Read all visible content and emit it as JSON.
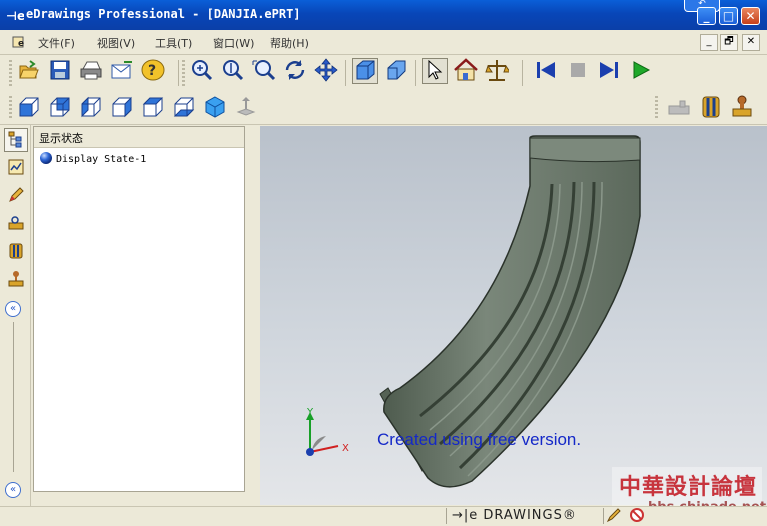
{
  "window": {
    "app_icon": "eDrawings logo",
    "title": "eDrawings Professional - [DANJIA.ePRT]",
    "minimize": "_",
    "maximize": "□",
    "close": "✕",
    "tooltip_tab": "↶"
  },
  "menu": {
    "items": [
      "文件(F)",
      "视图(V)",
      "工具(T)",
      "窗口(W)",
      "帮助(H)"
    ],
    "mdi_minimize": "_",
    "mdi_restore": "🗗",
    "mdi_close": "✕"
  },
  "toolbar1": {
    "icons": [
      "open-icon",
      "save-icon",
      "print-icon",
      "send-mail-icon",
      "help-icon",
      "zoom-to-fit-icon",
      "zoom-in-out-icon",
      "zoom-to-area-icon",
      "rotate-icon",
      "pan-icon",
      "3d-view-icon",
      "shaded-icon",
      "select-icon",
      "home-icon",
      "measure-icon",
      "first-frame-icon",
      "stop-icon",
      "next-frame-icon",
      "play-icon"
    ]
  },
  "toolbar2": {
    "icons": [
      "front-view-icon",
      "back-view-icon",
      "left-view-icon",
      "right-view-icon",
      "top-view-icon",
      "bottom-view-icon",
      "isometric-icon",
      "section-arrow-icon",
      "stamp-disabled-icon",
      "section-view-icon",
      "stamp-icon"
    ]
  },
  "left_strip": {
    "icons": [
      "component-tree-icon",
      "configurations-icon",
      "markup-pen-icon",
      "measure-tool-icon",
      "section-tool-icon",
      "stamp-tool-icon"
    ],
    "collapse_top": "«",
    "collapse_bottom": "«"
  },
  "panel": {
    "title": "显示状态",
    "items": [
      {
        "label": "Display State-1",
        "icon": "blue-sphere-icon"
      }
    ]
  },
  "viewport": {
    "watermark": "Created using free version.",
    "axes": {
      "x": "X",
      "y": "Y"
    }
  },
  "overlay": {
    "brand_name": "中華設計論壇",
    "brand_url": "bbs.chinade.net"
  },
  "status": {
    "logo": "→|e DRAWINGS®"
  },
  "colors": {
    "title_bar": "#0846b8",
    "model": "#6b786b",
    "watermark": "#1428c8",
    "brand": "#c4202a"
  }
}
